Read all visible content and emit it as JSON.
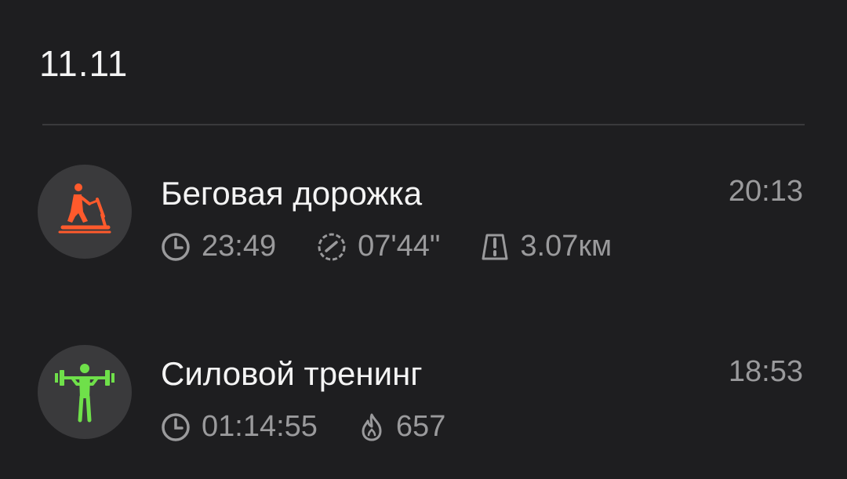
{
  "date": "11.11",
  "workouts": [
    {
      "title": "Беговая дорожка",
      "time": "20:13",
      "icon": "treadmill-icon",
      "icon_color": "#ff5a2c",
      "stats": {
        "duration": "23:49",
        "pace": "07'44\"",
        "distance": "3.07км"
      }
    },
    {
      "title": "Силовой тренинг",
      "time": "18:53",
      "icon": "weightlifting-icon",
      "icon_color": "#6fe04a",
      "stats": {
        "duration": "01:14:55",
        "calories": "657"
      }
    }
  ],
  "colors": {
    "background": "#1e1e20",
    "icon_circle": "#3a3a3c",
    "secondary_text": "#9a9a9c",
    "primary_text": "#f4f4f4"
  }
}
